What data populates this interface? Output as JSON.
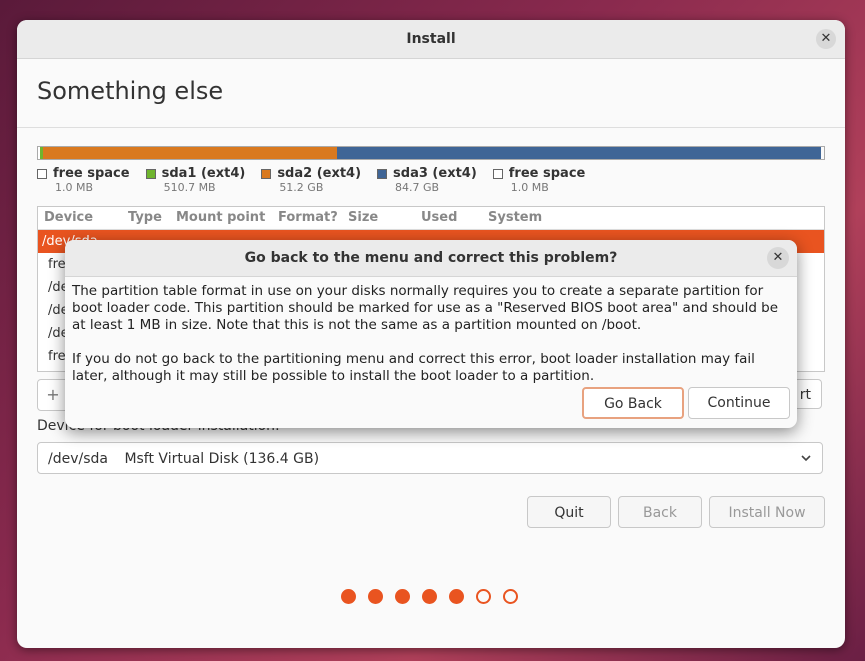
{
  "window": {
    "title": "Install",
    "close_glyph": "✕"
  },
  "page": {
    "title": "Something else"
  },
  "partition_bar": {
    "segments": [
      {
        "name": "free space",
        "color": "#ffffff",
        "fraction": 0.0002
      },
      {
        "name": "sda1",
        "color": "#6fb52e",
        "fraction": 0.004
      },
      {
        "name": "sda2",
        "color": "#d9791f",
        "fraction": 0.377
      },
      {
        "name": "sda3",
        "color": "#3f6596",
        "fraction": 0.619
      }
    ]
  },
  "legend": [
    {
      "label": "free space",
      "size": "1.0 MB",
      "color": "#ffffff"
    },
    {
      "label": "sda1 (ext4)",
      "size": "510.7 MB",
      "color": "#6fb52e"
    },
    {
      "label": "sda2 (ext4)",
      "size": "51.2 GB",
      "color": "#d9791f"
    },
    {
      "label": "sda3 (ext4)",
      "size": "84.7 GB",
      "color": "#3f6596"
    },
    {
      "label": "free space",
      "size": "1.0 MB",
      "color": "#ffffff"
    }
  ],
  "table": {
    "columns": [
      "Device",
      "Type",
      "Mount point",
      "Format?",
      "Size",
      "Used",
      "System"
    ],
    "rows": [
      "/dev/sda",
      "fre",
      "/de",
      "/de",
      "/de",
      "fre"
    ]
  },
  "buttons": {
    "add": "+",
    "revert": "rt",
    "quit": "Quit",
    "back": "Back",
    "install_now": "Install Now"
  },
  "boot_loader": {
    "label": "Device for boot loader installation:",
    "device": "/dev/sda",
    "description": "Msft Virtual Disk (136.4 GB)"
  },
  "progress": {
    "total_steps": 7,
    "completed_steps": 5
  },
  "dialog": {
    "title": "Go back to the menu and correct this problem?",
    "close_glyph": "✕",
    "message_1": "The partition table format in use on your disks normally requires you to create a separate partition for boot loader code. This partition should be marked for use as a \"Reserved BIOS boot area\" and should be at least 1 MB in size. Note that this is not the same as a partition mounted on /boot.",
    "message_2": "If you do not go back to the partitioning menu and correct this error, boot loader installation may fail later, although it may still be possible to install the boot loader to a partition.",
    "go_back": "Go Back",
    "continue": "Continue"
  },
  "colors": {
    "accent": "#e95420"
  }
}
